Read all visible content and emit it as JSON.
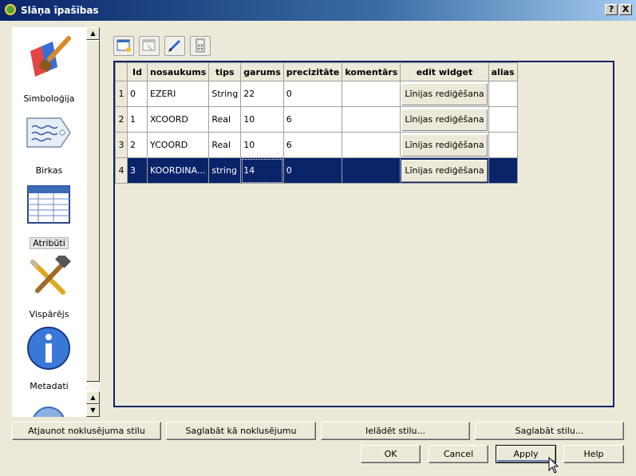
{
  "window": {
    "title": "Slāņa īpašības",
    "help_label": "?",
    "close_label": "X"
  },
  "sidebar": {
    "items": [
      {
        "label": "Simboloģija",
        "icon": "paintbrush-icon"
      },
      {
        "label": "Birkas",
        "icon": "label-tag-icon"
      },
      {
        "label": "Atribūti",
        "icon": "attribute-table-icon",
        "selected": true
      },
      {
        "label": "Vispārējs",
        "icon": "tools-icon"
      },
      {
        "label": "Metadati",
        "icon": "info-icon"
      },
      {
        "label": "",
        "icon": "gear-icon"
      }
    ]
  },
  "toolbar": [
    {
      "name": "new-column-icon"
    },
    {
      "name": "delete-column-icon"
    },
    {
      "name": "edit-mode-icon"
    },
    {
      "name": "field-calculator-icon"
    }
  ],
  "table": {
    "columns": [
      "",
      "Id",
      "nosaukums",
      "tips",
      "garums",
      "precizitāte",
      "komentārs",
      "edit widget",
      "alias"
    ],
    "rows": [
      {
        "rownum": "1",
        "id": "0",
        "nosaukums": "EZERI",
        "tips": "String",
        "garums": "22",
        "precizitate": "0",
        "komentars": "",
        "widget": "Līnijas rediģēšana",
        "alias": ""
      },
      {
        "rownum": "2",
        "id": "1",
        "nosaukums": "XCOORD",
        "tips": "Real",
        "garums": "10",
        "precizitate": "6",
        "komentars": "",
        "widget": "Līnijas rediģēšana",
        "alias": ""
      },
      {
        "rownum": "3",
        "id": "2",
        "nosaukums": "YCOORD",
        "tips": "Real",
        "garums": "10",
        "precizitate": "6",
        "komentars": "",
        "widget": "Līnijas rediģēšana",
        "alias": ""
      },
      {
        "rownum": "4",
        "id": "3",
        "nosaukums": "KOORDINA...",
        "tips": "string",
        "garums": "14",
        "precizitate": "0",
        "komentars": "",
        "widget": "Līnijas rediģēšana",
        "alias": "",
        "selected": true
      }
    ]
  },
  "style_buttons": {
    "restore": "Atjaunot noklusējuma stilu",
    "save_default": "Saglabāt kā noklusējumu",
    "load": "Ielādēt stilu...",
    "save": "Saglabāt stilu..."
  },
  "dialog_buttons": {
    "ok": "OK",
    "cancel": "Cancel",
    "apply": "Apply",
    "help": "Help"
  },
  "colors": {
    "title_bar": "#0a246a",
    "selection": "#0a246a",
    "face": "#ece9d8"
  }
}
